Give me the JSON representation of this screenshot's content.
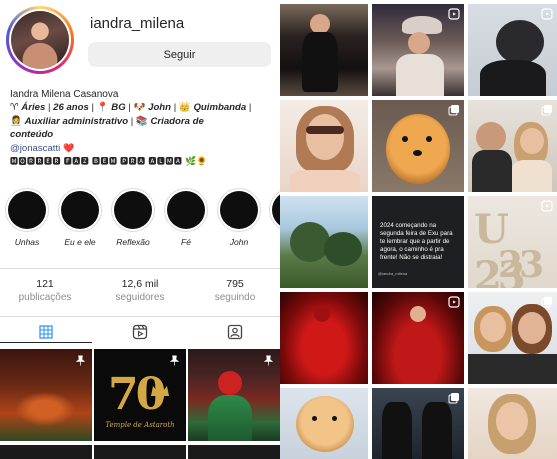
{
  "profile": {
    "username": "iandra_milena",
    "follow_label": "Seguir",
    "full_name": "Iandra Milena Casanova",
    "bio_line1_prefix": "♈ ",
    "bio_line1_a": "Áries",
    "bio_line1_sep1": " | ",
    "bio_line1_b": "26 anos",
    "bio_line1_sep2": " | 📍 ",
    "bio_line1_c": "BG",
    "bio_line1_sep3": " | 🐶 ",
    "bio_line1_d": "John",
    "bio_line1_sep4": " | 👑 ",
    "bio_line1_e": "Quimbanda",
    "bio_line1_end": " |",
    "bio_line2_prefix": "👩‍💼 ",
    "bio_line2_a": "Auxiliar administrativo",
    "bio_line2_sep": " | 📚 ",
    "bio_line2_b": "Criadora de",
    "bio_line3": "conteúdo",
    "mention": "@jonascatti",
    "heart": "❤️",
    "motto": "🅼🅾🆁🆁🅴🆁 🅵🅰🆉 🅱🅴🅼 🅿🆁🅰 🅰🅻🅼🅰",
    "motto_emoji": "🌿🌻"
  },
  "highlights": [
    {
      "label": "Unhas"
    },
    {
      "label": "Eu e ele"
    },
    {
      "label": "Reflexão"
    },
    {
      "label": "Fé"
    },
    {
      "label": "John"
    },
    {
      "label": ""
    }
  ],
  "stats": {
    "posts_value": "121",
    "posts_label": "publicações",
    "followers_value": "12,6 mil",
    "followers_label": "seguidores",
    "following_value": "795",
    "following_label": "seguindo"
  },
  "tabs": [
    {
      "icon": "grid-icon",
      "active": true
    },
    {
      "icon": "reels-icon",
      "active": false
    },
    {
      "icon": "tagged-icon",
      "active": false
    }
  ],
  "left_grid": {
    "temple_text": "Temple de Astaroth",
    "big_number": "70"
  },
  "right_grid": {
    "text_post": "2024 começando na segunda feira de Exu para te lembrar que a partir de agora, o caminho é pra frente! Não se distraia!",
    "text_post_tag": "@iandra_milena",
    "year_digits": "U 23"
  },
  "colors": {
    "accent_border": "#dbdbdb",
    "button_bg": "#efefef",
    "text_primary": "#262626",
    "text_secondary": "#8e8e8e",
    "mention": "#385185"
  }
}
